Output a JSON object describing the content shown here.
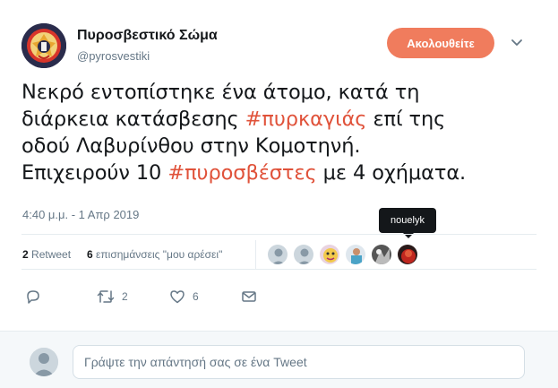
{
  "account": {
    "name": "Πυροσβεστικό Σώμα",
    "handle": "@pyrosvestiki",
    "follow_label": "Ακολουθείτε"
  },
  "tweet": {
    "line1": "Νεκρό εντοπίστηκε ένα άτομο, κατά τη",
    "line2_pre": "διάρκεια κατάσβεσης ",
    "hashtag1": "#πυρκαγιάς",
    "line2_post": " επί της",
    "line3": "οδού Λαβυρίνθου στην Κομοτηνή.",
    "line4_pre": "Επιχειρούν 10 ",
    "hashtag2": "#πυροσβέστες",
    "line4_post": " με 4 οχήματα.",
    "timestamp": "4:40 μ.μ. - 1 Απρ 2019"
  },
  "tooltip": {
    "text": "nouelyk"
  },
  "stats": {
    "retweet_count": "2",
    "retweet_label": "Retweet",
    "like_count": "6",
    "like_label": "επισημάνσεις \"μου αρέσει\""
  },
  "actions": {
    "retweet_count": "2",
    "like_count": "6"
  },
  "reply": {
    "placeholder": "Γράψτε την απάντησή σας σε ένα Tweet"
  },
  "colors": {
    "accent": "#e0523a",
    "follow_bg": "#f07c5d",
    "muted": "#657786"
  }
}
